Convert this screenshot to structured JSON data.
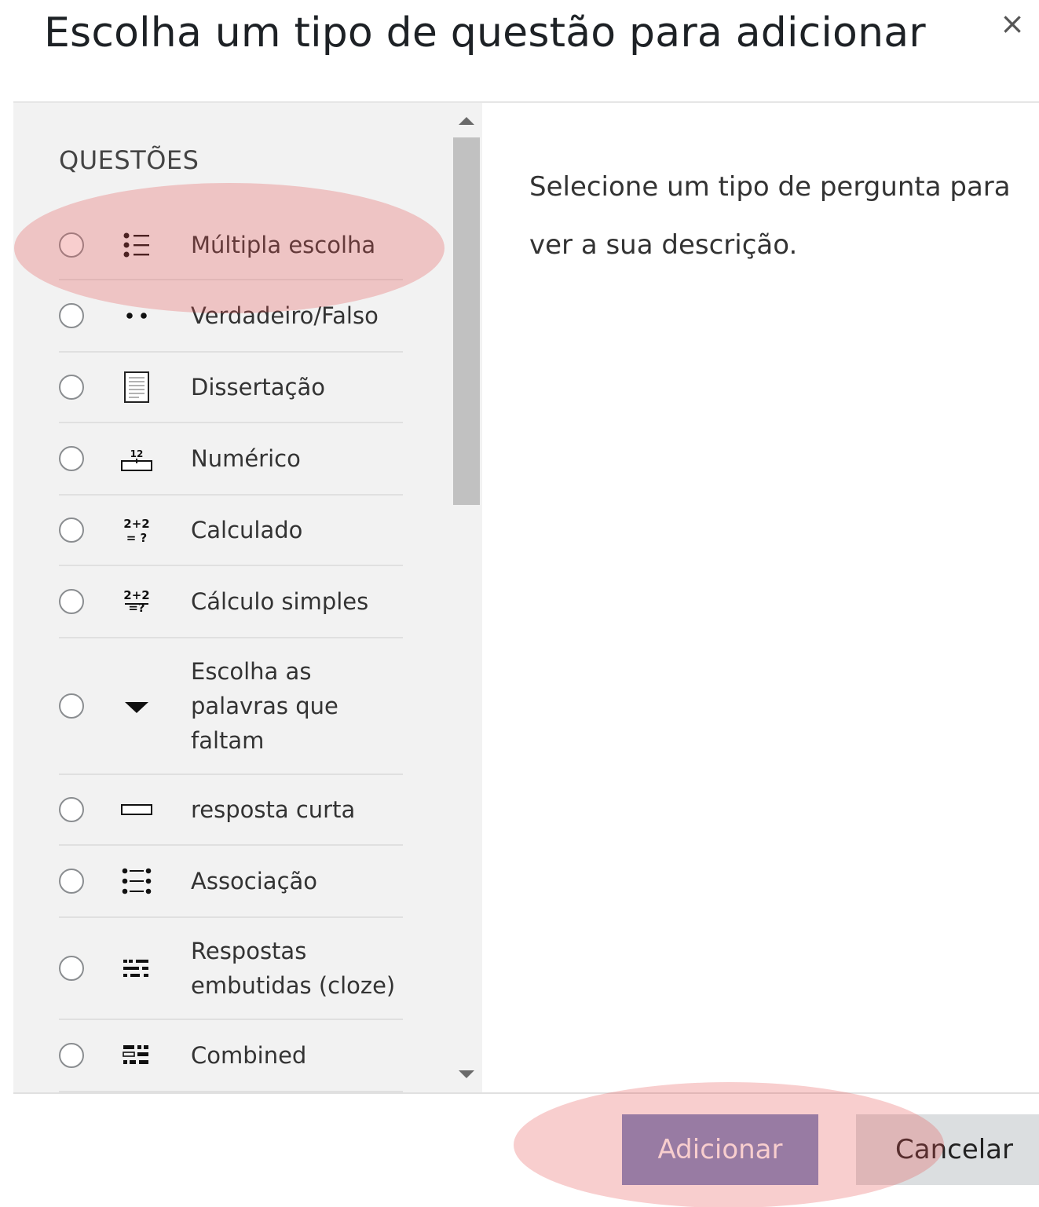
{
  "dialog": {
    "title": "Escolha um tipo de questão para adicionar",
    "close_symbol": "×"
  },
  "list": {
    "section_label": "QUESTÕES",
    "options": [
      {
        "label": "Múltipla escolha",
        "icon": "multichoice-icon"
      },
      {
        "label": "Verdadeiro/Falso",
        "icon": "truefalse-icon"
      },
      {
        "label": "Dissertação",
        "icon": "essay-icon"
      },
      {
        "label": "Numérico",
        "icon": "numerical-icon"
      },
      {
        "label": "Calculado",
        "icon": "calculated-icon"
      },
      {
        "label": "Cálculo simples",
        "icon": "calculated-simple-icon"
      },
      {
        "label": "Escolha as palavras que faltam",
        "icon": "dropdown-triangle-icon"
      },
      {
        "label": "resposta curta",
        "icon": "short-answer-icon"
      },
      {
        "label": "Associação",
        "icon": "matching-icon"
      },
      {
        "label": "Respostas embutidas (cloze)",
        "icon": "cloze-icon"
      },
      {
        "label": "Combined",
        "icon": "combined-icon"
      }
    ]
  },
  "description": {
    "text": "Selecione um tipo de pergunta para ver a sua descrição."
  },
  "footer": {
    "add_label": "Adicionar",
    "cancel_label": "Cancelar"
  },
  "colors": {
    "primary_button": "#7b8cc4",
    "secondary_button": "#dbdee0",
    "left_panel_bg": "#f2f2f2",
    "highlight": "#e65050"
  }
}
